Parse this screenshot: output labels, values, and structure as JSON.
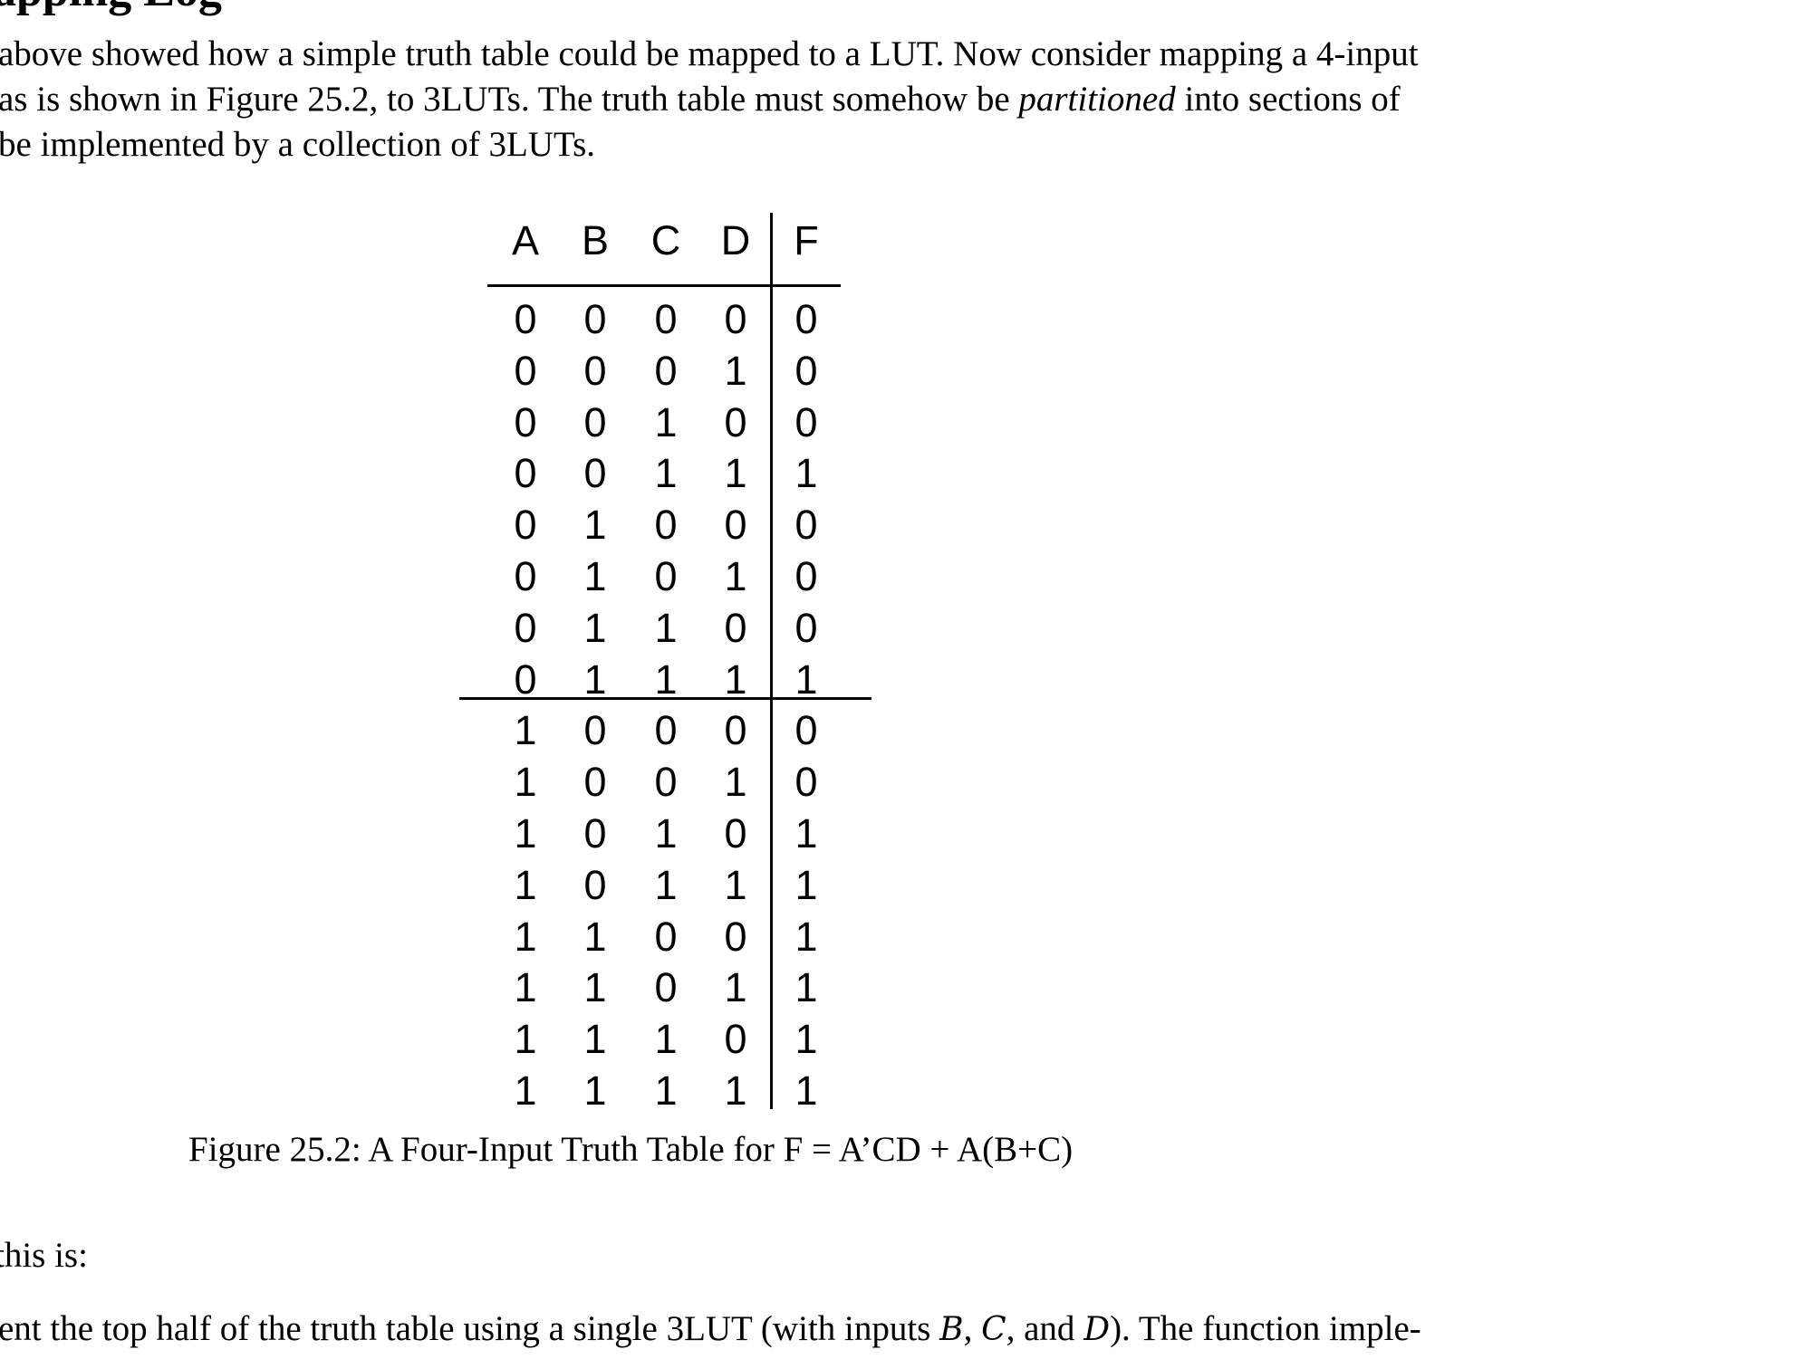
{
  "heading": "apping Log",
  "para1": {
    "line1": "above showed how a simple truth table could be mapped to a LUT. Now consider mapping a 4-input",
    "line2_pre": " as is shown in Figure 25.2, to 3LUTs.  The truth table must somehow be ",
    "line2_em": "partitioned",
    "line2_post": " into sections of",
    "line3": "be implemented by a collection of 3LUTs."
  },
  "truth_table": {
    "headers": [
      "A",
      "B",
      "C",
      "D",
      "F"
    ],
    "rows": [
      [
        "0",
        "0",
        "0",
        "0",
        "0"
      ],
      [
        "0",
        "0",
        "0",
        "1",
        "0"
      ],
      [
        "0",
        "0",
        "1",
        "0",
        "0"
      ],
      [
        "0",
        "0",
        "1",
        "1",
        "1"
      ],
      [
        "0",
        "1",
        "0",
        "0",
        "0"
      ],
      [
        "0",
        "1",
        "0",
        "1",
        "0"
      ],
      [
        "0",
        "1",
        "1",
        "0",
        "0"
      ],
      [
        "0",
        "1",
        "1",
        "1",
        "1"
      ],
      [
        "1",
        "0",
        "0",
        "0",
        "0"
      ],
      [
        "1",
        "0",
        "0",
        "1",
        "0"
      ],
      [
        "1",
        "0",
        "1",
        "0",
        "1"
      ],
      [
        "1",
        "0",
        "1",
        "1",
        "1"
      ],
      [
        "1",
        "1",
        "0",
        "0",
        "1"
      ],
      [
        "1",
        "1",
        "0",
        "1",
        "1"
      ],
      [
        "1",
        "1",
        "1",
        "0",
        "1"
      ],
      [
        "1",
        "1",
        "1",
        "1",
        "1"
      ]
    ]
  },
  "caption": "Figure 25.2: A Four-Input Truth Table for F = A’CD + A(B+C)",
  "para2": {
    "line1": " this is:",
    "line2_a": "ent the top half of the truth table using a single 3LUT (with inputs ",
    "var_b": "B",
    "sep1": ", ",
    "var_c": "C",
    "sep2": ", and ",
    "var_d": "D",
    "line2_b": ").  The function imple-"
  }
}
